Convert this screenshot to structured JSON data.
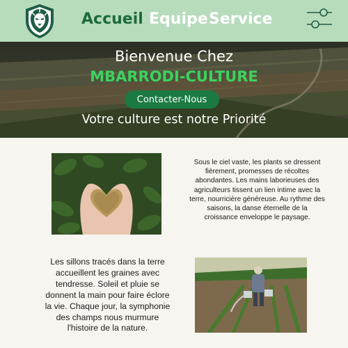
{
  "nav": {
    "logo_icon": "lion-head-shield-logo",
    "items": [
      {
        "label": "Accueil",
        "active": true
      },
      {
        "label": "Equipe",
        "active": false
      },
      {
        "label": "Service",
        "active": false
      }
    ],
    "menu_icon": "sliders-toggle-icon",
    "colors": {
      "background": "#b7dcbc",
      "active": "#1c6b3d",
      "inactive": "#ffffff"
    }
  },
  "hero": {
    "welcome": "Bienvenue Chez",
    "brand": "MBARRODI-CULTURE",
    "cta_label": "Contacter-Nous",
    "tagline": "Votre culture est notre Priorité",
    "colors": {
      "brand": "#3ed15f",
      "cta": "#1b7a42"
    }
  },
  "sections": [
    {
      "image": "hands-holding-grain-heart",
      "text": "Sous le ciel vaste, les plants se dressent fièrement, promesses de récoltes abondantes. Les mains laborieuses des agriculteurs tissent un lien intime avec la terre, nourricière généreuse. Au rythme des saisons, la danse éternelle de la croissance enveloppe le paysage."
    },
    {
      "image": "farmer-watering-crops",
      "text": "Les sillons tracés dans la terre accueillent les graines avec tendresse. Soleil et pluie se donnent la main pour faire éclore la vie. Chaque jour, la symphonie des champs nous murmure l'histoire de la nature."
    }
  ]
}
